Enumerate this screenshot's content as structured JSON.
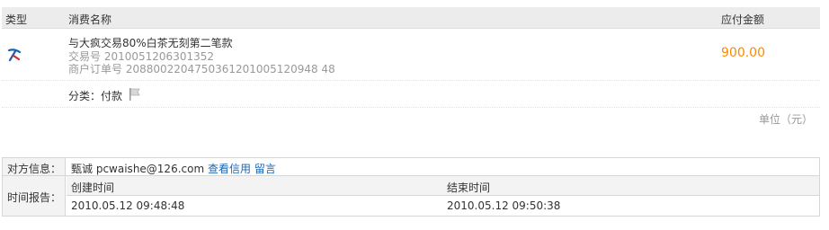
{
  "order_table": {
    "header": {
      "type": "类型",
      "name": "消费名称",
      "amount": "应付金额"
    },
    "order": {
      "icon": "trade-type-icon",
      "name": "与大疯交易80%白茶无刻第二笔款",
      "trade_no_label": "交易号",
      "trade_no": "2010051206301352",
      "merchant_order_label": "商户订单号",
      "merchant_order_no": "2088002204750361201005120948 48",
      "amount": "900.00"
    },
    "category": {
      "label": "分类：付款",
      "icon": "flag-icon"
    },
    "unit": "单位（元）"
  },
  "info_table": {
    "counterpart_label": "对方信息：",
    "counterpart_name": "甄诚",
    "counterpart_email": "pcwaishe@126.com",
    "credit_link": "查看信用",
    "message_link": "留言",
    "time_label": "时间报告：",
    "created_header": "创建时间",
    "ended_header": "结束时间",
    "created_time": "2010.05.12 09:48:48",
    "ended_time": "2010.05.12 09:50:38"
  },
  "colors": {
    "amount": "#ff8800",
    "link": "#1a66b3",
    "muted": "#999999",
    "header_bg": "#ececec"
  }
}
